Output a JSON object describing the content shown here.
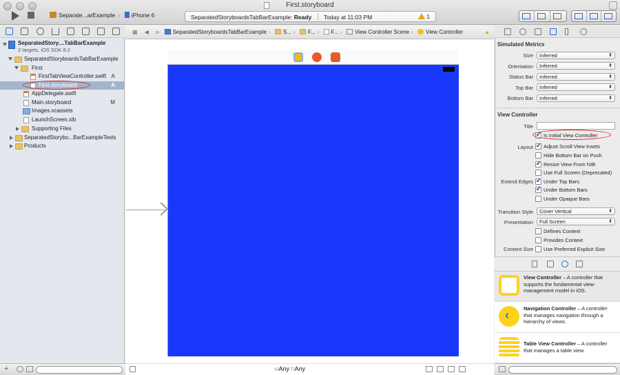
{
  "window": {
    "title": "First.storyboard"
  },
  "toolbar": {
    "scheme_name": "Separate...arExample",
    "scheme_sep": "›",
    "device": "iPhone 6",
    "activity_project": "SeparatedStoryboardsTabBarExample:",
    "activity_status": "Ready",
    "activity_time": "Today at 11:03 PM",
    "warning_count": "1"
  },
  "navigator": {
    "project": {
      "name": "SeparatedStory....TabBarExample",
      "subtitle": "2 targets, iOS SDK 8.2"
    },
    "rows": [
      {
        "label": "SeparatedStoryboardsTabBarExample",
        "status": ""
      },
      {
        "label": "First",
        "status": ""
      },
      {
        "label": "FirstTabViewController.swift",
        "status": "A"
      },
      {
        "label": "First.storyboard",
        "status": "A"
      },
      {
        "label": "AppDelegate.swift",
        "status": ""
      },
      {
        "label": "Main.storyboard",
        "status": "M"
      },
      {
        "label": "Images.xcassets",
        "status": ""
      },
      {
        "label": "LaunchScreen.xib",
        "status": ""
      },
      {
        "label": "Supporting Files",
        "status": ""
      },
      {
        "label": "SeparatedStorybo...BarExampleTests",
        "status": ""
      },
      {
        "label": "Products",
        "status": ""
      }
    ]
  },
  "jumpbar": {
    "crumbs": [
      "SeparatedStoryboardsTabBarExample",
      "S...",
      "F...",
      "F...",
      "View Controller Scene",
      "View Controller"
    ]
  },
  "editor": {
    "size_class_w_prefix": "w",
    "size_class_w": "Any",
    "size_class_h_prefix": "h",
    "size_class_h": "Any"
  },
  "inspector": {
    "simulated_metrics": {
      "header": "Simulated Metrics",
      "fields": [
        {
          "label": "Size",
          "value": "Inferred"
        },
        {
          "label": "Orientation",
          "value": "Inferred"
        },
        {
          "label": "Status Bar",
          "value": "Inferred"
        },
        {
          "label": "Top Bar",
          "value": "Inferred"
        },
        {
          "label": "Bottom Bar",
          "value": "Inferred"
        }
      ]
    },
    "view_controller": {
      "header": "View Controller",
      "title_label": "Title",
      "title_value": "",
      "initial_label": "Is Initial View Controller",
      "initial_checked": true,
      "layout_label": "Layout",
      "extend_label": "Extend Edges",
      "checks": [
        {
          "label": "Adjust Scroll View Insets",
          "checked": true
        },
        {
          "label": "Hide Bottom Bar on Push",
          "checked": false
        },
        {
          "label": "Resize View From NIB",
          "checked": true
        },
        {
          "label": "Use Full Screen (Deprecated)",
          "checked": false
        },
        {
          "label": "Under Top Bars",
          "checked": true
        },
        {
          "label": "Under Bottom Bars",
          "checked": true
        },
        {
          "label": "Under Opaque Bars",
          "checked": false
        }
      ],
      "transition_label": "Transition Style",
      "transition_value": "Cover Vertical",
      "presentation_label": "Presentation",
      "presentation_value": "Full Screen",
      "defines_context": "Defines Context",
      "provides_context": "Provides Context",
      "content_size_label": "Content Size",
      "content_size_check": "Use Preferred Explicit Size"
    },
    "library": [
      {
        "title": "View Controller",
        "desc": " – A controller that supports the fundamental view-management model in iOS."
      },
      {
        "title": "Navigation Controller",
        "desc": " – A controller that manages navigation through a hierarchy of views."
      },
      {
        "title": "Table View Controller",
        "desc": " – A controller that manages a table view."
      }
    ]
  },
  "colors": {
    "canvas_view": "#1839fb",
    "selection": "#a3b4cd",
    "annotation": "#d0241c",
    "accent": "#2a6fd6"
  }
}
